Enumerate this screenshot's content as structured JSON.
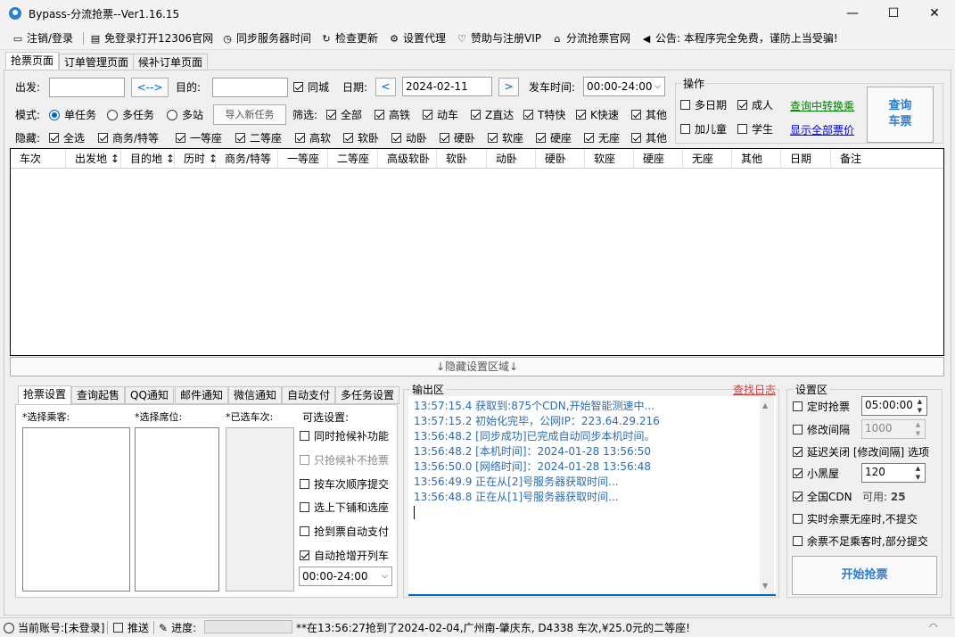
{
  "window": {
    "title": "Bypass-分流抢票--Ver1.16.15"
  },
  "menu": [
    {
      "icon": "monitor-icon",
      "label": "注销/登录"
    },
    {
      "icon": "window-icon",
      "label": "免登录打开12306官网"
    },
    {
      "icon": "clock-icon",
      "label": "同步服务器时间"
    },
    {
      "icon": "refresh-icon",
      "label": "检查更新"
    },
    {
      "icon": "gear-icon",
      "label": "设置代理"
    },
    {
      "icon": "heart-icon",
      "label": "赞助与注册VIP"
    },
    {
      "icon": "home-icon",
      "label": "分流抢票官网"
    },
    {
      "icon": "speaker-icon",
      "label": "公告: 本程序完全免费，谨防上当受骗!"
    }
  ],
  "tabs": [
    "抢票页面",
    "订单管理页面",
    "候补订单页面"
  ],
  "search": {
    "from_label": "出发:",
    "from_value": "",
    "swap_label": "<-->",
    "to_label": "目的:",
    "to_value": "",
    "same_city_label": "同城",
    "date_label": "日期:",
    "date_value": "2024-02-11",
    "prev": "<",
    "next": ">",
    "time_label": "发车时间:",
    "time_value": "00:00-24:00"
  },
  "mode": {
    "label": "模式:",
    "options": [
      "单任务",
      "多任务",
      "多站"
    ],
    "import_button": "导入新任务",
    "filter_label": "筛选:",
    "filters": [
      "全部",
      "高铁",
      "动车",
      "Z直达",
      "T特快",
      "K快速",
      "其他"
    ]
  },
  "hide": {
    "label": "隐藏:",
    "items": [
      "全选",
      "商务/特等",
      "一等座",
      "二等座",
      "高软",
      "软卧",
      "动卧",
      "硬卧",
      "软座",
      "硬座",
      "无座",
      "其他"
    ]
  },
  "ops": {
    "title": "操作",
    "multi_date": "多日期",
    "adult": "成人",
    "child": "加儿童",
    "student": "学生",
    "transfer_link": "查询中转换乘",
    "show_price_link": "显示全部票价",
    "query_button": "查询\n车票",
    "query_l1": "查询",
    "query_l2": "车票"
  },
  "table_columns": [
    "车次",
    "出发地 ↕",
    "目的地 ↕",
    "历时 ↕",
    "商务/特等",
    "一等座",
    "二等座",
    "高级软卧",
    "软卧",
    "动卧",
    "硬卧",
    "软座",
    "硬座",
    "无座",
    "其他",
    "日期",
    "备注"
  ],
  "hide_settings": "↓隐藏设置区域↓",
  "bottom_tabs": [
    "抢票设置",
    "查询起售",
    "QQ通知",
    "邮件通知",
    "微信通知",
    "自动支付",
    "多任务设置"
  ],
  "grab": {
    "passenger_label": "*选择乘客:",
    "seat_label": "*选择席位:",
    "train_label": "*已选车次:",
    "optional_label": "可选设置:",
    "options": [
      {
        "label": "同时抢候补功能",
        "checked": false,
        "disabled": false
      },
      {
        "label": "只抢候补不抢票",
        "checked": false,
        "disabled": true
      },
      {
        "label": "按车次顺序提交",
        "checked": false,
        "disabled": false
      },
      {
        "label": "选上下铺和选座",
        "checked": false,
        "disabled": false
      },
      {
        "label": "抢到票自动支付",
        "checked": false,
        "disabled": false
      },
      {
        "label": "自动抢增开列车",
        "checked": true,
        "disabled": false
      }
    ],
    "time_select": "00:00-24:00"
  },
  "output": {
    "title": "输出区",
    "find_log": "查找日志",
    "lines": [
      "13:57:15.4  获取到:875个CDN,开始智能测速中...",
      "13:57:15.2  初始化完毕，公网IP：223.64.29.216",
      "13:56:48.2  [同步成功]已完成自动同步本机时间。",
      "13:56:48.2  [本机时间]：2024-01-28 13:56:50",
      "13:56:50.0  [网络时间]：2024-01-28 13:56:48",
      "13:56:49.9  正在从[2]号服务器获取时间...",
      "13:56:48.8  正在从[1]号服务器获取时间..."
    ]
  },
  "settings": {
    "title": "设置区",
    "timed_label": "定时抢票",
    "timed_value": "05:00:00",
    "interval_label": "修改间隔",
    "interval_value": "1000",
    "delay_label": "延迟关闭 [修改间隔] 选项",
    "blackroom_label": "小黑屋",
    "blackroom_value": "120",
    "cdn_label": "全国CDN",
    "cdn_avail_label": "可用:",
    "cdn_avail_value": "25",
    "no_seat_label": "实时余票无座时,不提交",
    "partial_label": "余票不足乘客时,部分提交",
    "start_button": "开始抢票"
  },
  "status": {
    "account": "当前账号:[未登录]",
    "push": "推送",
    "progress": "进度:",
    "progress_value": 0,
    "marquee": "**在13:56:27抢到了2024-02-04,广州南-肇庆东, D4338 车次,¥25.0元的二等座!"
  },
  "colors": {
    "accent": "#0067c0",
    "link_green": "#008000",
    "link_blue": "#0000ee",
    "log_blue": "#2b6cb0",
    "query_blue": "#2b7cd3"
  }
}
